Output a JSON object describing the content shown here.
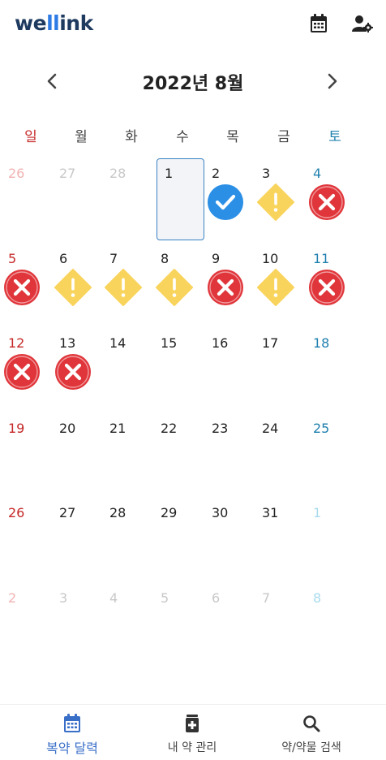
{
  "app": {
    "logo": {
      "pre": "we",
      "mid": "ll",
      "post": "ink"
    }
  },
  "header": {
    "calendar_icon": "calendar-icon",
    "settings_icon": "user-settings-icon"
  },
  "month_nav": {
    "title": "2022년 8월",
    "prev_icon": "chevron-left-icon",
    "next_icon": "chevron-right-icon"
  },
  "weekdays": [
    "일",
    "월",
    "화",
    "수",
    "목",
    "금",
    "토"
  ],
  "calendar": {
    "weeks": [
      [
        {
          "day": "26",
          "muted": true
        },
        {
          "day": "27",
          "muted": true
        },
        {
          "day": "28",
          "muted": true
        },
        {
          "day": "1",
          "today": true
        },
        {
          "day": "2",
          "status": "taken"
        },
        {
          "day": "3",
          "status": "partial"
        },
        {
          "day": "4",
          "status": "missed"
        }
      ],
      [
        {
          "day": "5",
          "status": "missed"
        },
        {
          "day": "6",
          "status": "partial"
        },
        {
          "day": "7",
          "status": "partial"
        },
        {
          "day": "8",
          "status": "partial"
        },
        {
          "day": "9",
          "status": "missed"
        },
        {
          "day": "10",
          "status": "partial"
        },
        {
          "day": "11",
          "status": "missed"
        }
      ],
      [
        {
          "day": "12",
          "status": "missed"
        },
        {
          "day": "13",
          "status": "missed"
        },
        {
          "day": "14"
        },
        {
          "day": "15"
        },
        {
          "day": "16"
        },
        {
          "day": "17"
        },
        {
          "day": "18"
        }
      ],
      [
        {
          "day": "19"
        },
        {
          "day": "20"
        },
        {
          "day": "21"
        },
        {
          "day": "22"
        },
        {
          "day": "23"
        },
        {
          "day": "24"
        },
        {
          "day": "25"
        }
      ],
      [
        {
          "day": "26"
        },
        {
          "day": "27"
        },
        {
          "day": "28"
        },
        {
          "day": "29"
        },
        {
          "day": "30"
        },
        {
          "day": "31"
        },
        {
          "day": "1",
          "muted": true
        }
      ],
      [
        {
          "day": "2",
          "muted": true
        },
        {
          "day": "3",
          "muted": true
        },
        {
          "day": "4",
          "muted": true
        },
        {
          "day": "5",
          "muted": true
        },
        {
          "day": "6",
          "muted": true
        },
        {
          "day": "7",
          "muted": true
        },
        {
          "day": "8",
          "muted": true
        }
      ]
    ]
  },
  "colors": {
    "taken": "#2b8fe6",
    "partial": "#f9d45c",
    "missed": "#e0363b",
    "active_tab": "#3a6fc8"
  },
  "bottom_nav": {
    "tabs": [
      {
        "label": "복약 달력",
        "icon": "calendar-icon",
        "active": true
      },
      {
        "label": "내 약 관리",
        "icon": "medicine-box-icon",
        "active": false
      },
      {
        "label": "약/약물 검색",
        "icon": "search-icon",
        "active": false
      }
    ]
  }
}
